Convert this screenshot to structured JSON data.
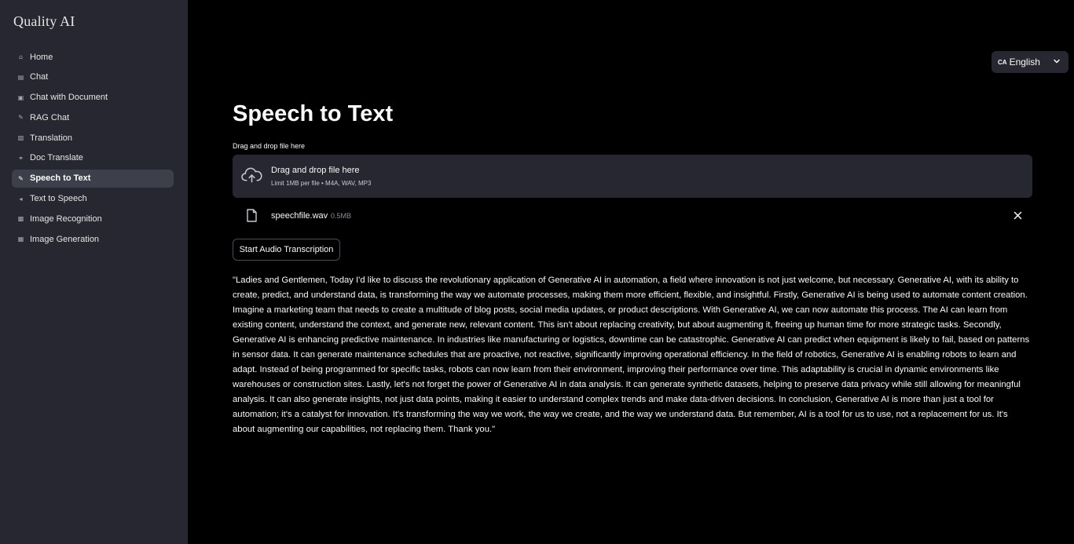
{
  "sidebar": {
    "brand": "Quality AI",
    "items": [
      {
        "label": "Home",
        "icon": "home-icon"
      },
      {
        "label": "Chat",
        "icon": "chat-icon"
      },
      {
        "label": "Chat with Document",
        "icon": "chat-document-icon"
      },
      {
        "label": "RAG Chat",
        "icon": "rag-icon"
      },
      {
        "label": "Translation",
        "icon": "translate-icon"
      },
      {
        "label": "Doc Translate",
        "icon": "doc-translate-icon"
      },
      {
        "label": "Speech to Text",
        "icon": "speech-to-text-icon",
        "active": true
      },
      {
        "label": "Text to Speech",
        "icon": "speaker-icon"
      },
      {
        "label": "Image Recognition",
        "icon": "image-recognition-icon"
      },
      {
        "label": "Image Generation",
        "icon": "image-generation-icon"
      }
    ]
  },
  "language": {
    "code": "CA",
    "value": "English"
  },
  "main": {
    "title": "Speech to Text",
    "uploader": {
      "label": "Drag and drop file here",
      "dropzone_title": "Drag and drop file here",
      "limit": "Limit 1MB per file • M4A, WAV, MP3"
    },
    "file": {
      "name": "speechfile.wav",
      "size": "0.5MB"
    },
    "start_button": "Start Audio Transcription",
    "transcript": "\"Ladies and Gentlemen, Today I'd like to discuss the revolutionary application of Generative AI in automation, a field where innovation is not just welcome, but necessary. Generative AI, with its ability to create, predict, and understand data, is transforming the way we automate processes, making them more efficient, flexible, and insightful. Firstly, Generative AI is being used to automate content creation. Imagine a marketing team that needs to create a multitude of blog posts, social media updates, or product descriptions. With Generative AI, we can now automate this process. The AI can learn from existing content, understand the context, and generate new, relevant content. This isn't about replacing creativity, but about augmenting it, freeing up human time for more strategic tasks. Secondly, Generative AI is enhancing predictive maintenance. In industries like manufacturing or logistics, downtime can be catastrophic. Generative AI can predict when equipment is likely to fail, based on patterns in sensor data. It can generate maintenance schedules that are proactive, not reactive, significantly improving operational efficiency. In the field of robotics, Generative AI is enabling robots to learn and adapt. Instead of being programmed for specific tasks, robots can now learn from their environment, improving their performance over time. This adaptability is crucial in dynamic environments like warehouses or construction sites. Lastly, let's not forget the power of Generative AI in data analysis. It can generate synthetic datasets, helping to preserve data privacy while still allowing for meaningful analysis. It can also generate insights, not just data points, making it easier to understand complex trends and make data-driven decisions. In conclusion, Generative AI is more than just a tool for automation; it's a catalyst for innovation. It's transforming the way we work, the way we create, and the way we understand data. But remember, AI is a tool for us to use, not a replacement for us. It's about augmenting our capabilities, not replacing them. Thank you.\""
  },
  "colors": {
    "background": "#000000",
    "sidebar": "#262730",
    "active_item": "#3d3f4b",
    "text": "#fafafa"
  }
}
